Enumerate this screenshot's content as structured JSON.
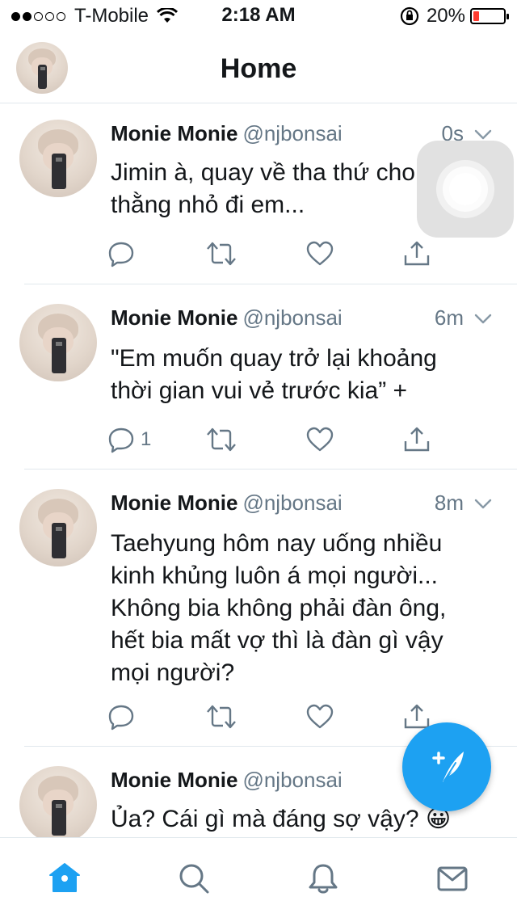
{
  "status_bar": {
    "carrier": "T-Mobile",
    "time": "2:18 AM",
    "battery_percent": "20%",
    "signal_bars_filled": 2,
    "signal_bars_total": 5,
    "battery_level": 0.2,
    "battery_color": "#ff3b30"
  },
  "header": {
    "title": "Home"
  },
  "colors": {
    "accent": "#1da1f2",
    "secondary_text": "#657786",
    "divider": "#e1e8ed"
  },
  "tweets": [
    {
      "name": "Monie Monie",
      "handle": "@njbonsai",
      "time": "0s",
      "text": "Jimin à, quay về tha thứ cho thằng nhỏ đi em...",
      "reply_count": ""
    },
    {
      "name": "Monie Monie",
      "handle": "@njbonsai",
      "time": "6m",
      "text": "\"Em muốn quay trở lại khoảng thời gian vui vẻ trước kia” +",
      "reply_count": "1"
    },
    {
      "name": "Monie Monie",
      "handle": "@njbonsai",
      "time": "8m",
      "text": "Taehyung hôm nay uống nhiều kinh khủng luôn á mọi người... Không bia không phải đàn ông, hết bia mất vợ thì là đàn gì vậy mọi người?",
      "reply_count": ""
    },
    {
      "name": "Monie Monie",
      "handle": "@njbonsai",
      "time": "",
      "text": "Ủa? Cái gì mà đáng sợ vậy? 😀",
      "reply_count": ""
    }
  ],
  "tab_bar": {
    "items": [
      {
        "icon": "home-icon",
        "active": true
      },
      {
        "icon": "search-icon",
        "active": false
      },
      {
        "icon": "notifications-icon",
        "active": false
      },
      {
        "icon": "messages-icon",
        "active": false
      }
    ]
  },
  "compose_button": {
    "icon": "compose-feather-icon"
  }
}
